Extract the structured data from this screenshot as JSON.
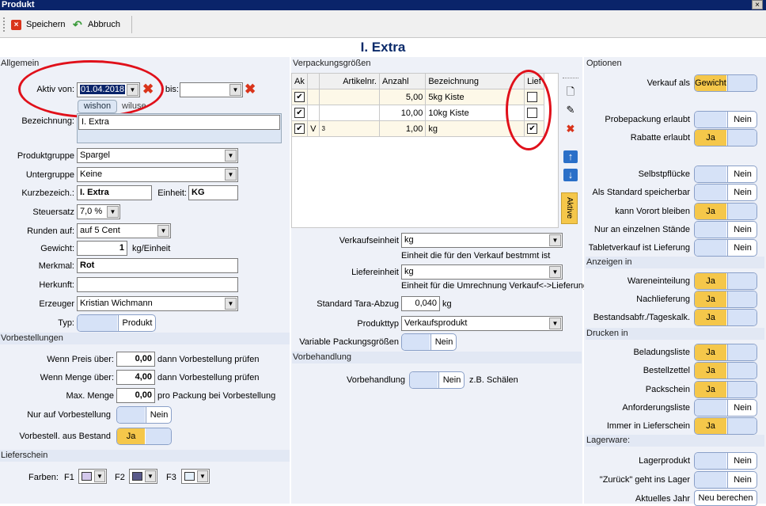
{
  "window": {
    "title": "Produkt",
    "close": "×"
  },
  "toolbar": {
    "save": "Speichern",
    "cancel": "Abbruch"
  },
  "page_title": "I. Extra",
  "allgemein": {
    "section": "Allgemein",
    "aktiv_von_label": "Aktiv von:",
    "aktiv_von": "01.04.2018",
    "bis_label": "bis:",
    "bis": "",
    "wishon": "wishon",
    "wiluse": "wiluse",
    "bezeichnung_label": "Bezeichnung:",
    "bezeichnung": "I. Extra",
    "produktgruppe_label": "Produktgruppe",
    "produktgruppe": "Spargel",
    "untergruppe_label": "Untergruppe",
    "untergruppe": "Keine",
    "kurzbez_label": "Kurzbezeich.:",
    "kurzbez": "I. Extra",
    "einheit_label": "Einheit:",
    "einheit": "KG",
    "steuersatz_label": "Steuersatz",
    "steuersatz": "7,0 %",
    "runden_label": "Runden auf:",
    "runden": "auf 5 Cent",
    "gewicht_label": "Gewicht:",
    "gewicht": "1",
    "gewicht_unit": "kg/Einheit",
    "merkmal_label": "Merkmal:",
    "merkmal": "Rot",
    "herkunft_label": "Herkunft:",
    "herkunft": "",
    "erzeuger_label": "Erzeuger",
    "erzeuger": "Kristian Wichmann",
    "typ_label": "Typ:",
    "typ": "Produkt"
  },
  "vorbestellungen": {
    "section": "Vorbestellungen",
    "preis_label": "Wenn Preis über:",
    "preis": "0,00",
    "preis_suffix": "dann Vorbestellung prüfen",
    "menge_label": "Wenn Menge über:",
    "menge": "4,00",
    "menge_suffix": "dann Vorbestellung prüfen",
    "max_label": "Max. Menge",
    "max": "0,00",
    "max_suffix": "pro Packung bei Vorbestellung",
    "nur_label": "Nur auf Vorbestellung",
    "nur": "Nein",
    "bestand_label": "Vorbestell. aus Bestand",
    "bestand": "Ja"
  },
  "lieferschein": {
    "section": "Lieferschein",
    "farben_label": "Farben:",
    "f1": "F1",
    "f2": "F2",
    "f3": "F3",
    "f1_color": "#d4c8ec",
    "f2_color": "#5a5a8a",
    "f3_color": "#e4f0fa"
  },
  "verpackung": {
    "section": "Verpackungsgrößen",
    "headers": [
      "Ak",
      "",
      "Artikelnr.",
      "Anzahl",
      "Bezeichnung",
      "Lief"
    ],
    "rows": [
      {
        "ak": "✔",
        "v": "",
        "art": "",
        "anzahl": "5,00",
        "bez": "5kg Kiste",
        "lief": ""
      },
      {
        "ak": "✔",
        "v": "",
        "art": "",
        "anzahl": "10,00",
        "bez": "10kg Kiste",
        "lief": ""
      },
      {
        "ak": "✔",
        "v": "V",
        "art": "3",
        "anzahl": "1,00",
        "bez": "kg",
        "lief": "✔"
      }
    ],
    "aktive_tab": "Aktive"
  },
  "mitte": {
    "verkaufseinheit_label": "Verkaufseinheit",
    "verkaufseinheit": "kg",
    "verkaufseinheit_hint": "Einheit die für den Verkauf bestmmt ist",
    "liefereinheit_label": "Liefereinheit",
    "liefereinheit": "kg",
    "liefereinheit_hint": "Einheit für die Umrechnung Verkauf<->Lieferung",
    "tara_label": "Standard Tara-Abzug",
    "tara": "0,040",
    "tara_unit": "kg",
    "produkttyp_label": "Produkttyp",
    "produkttyp": "Verkaufsprodukt",
    "variable_label": "Variable Packungsgrößen",
    "variable": "Nein",
    "vorbehandlung_section": "Vorbehandlung",
    "vorbehandlung_label": "Vorbehandlung",
    "vorbehandlung": "Nein",
    "vorbehandlung_hint": "z.B. Schälen"
  },
  "optionen": {
    "section": "Optionen",
    "verkauf_label": "Verkauf als",
    "verkauf": "Gewicht",
    "probe_label": "Probepackung erlaubt",
    "probe": "Nein",
    "rabatte_label": "Rabatte erlaubt",
    "rabatte": "Ja",
    "selbst_label": "Selbstpflücke",
    "selbst": "Nein",
    "standard_label": "Als Standard speicherbar",
    "standard": "Nein",
    "vorort_label": "kann Vorort bleiben",
    "vorort": "Ja",
    "staende_label": "Nur an einzelnen Stände",
    "staende": "Nein",
    "tablet_label": "Tabletverkauf ist Lieferung",
    "tablet": "Nein",
    "anzeigen_section": "Anzeigen in",
    "waren_label": "Wareneinteilung",
    "waren": "Ja",
    "nach_label": "Nachlieferung",
    "nach": "Ja",
    "bestand_label": "Bestandsabfr./Tageskalk.",
    "bestand": "Ja",
    "drucken_section": "Drucken in",
    "belad_label": "Beladungsliste",
    "belad": "Ja",
    "bestell_label": "Bestellzettel",
    "bestell": "Ja",
    "pack_label": "Packschein",
    "pack": "Ja",
    "anford_label": "Anforderungsliste",
    "anford": "Nein",
    "immer_label": "Immer in Lieferschein",
    "immer": "Ja",
    "lager_section": "Lagerware:",
    "lagerprodukt_label": "Lagerprodukt",
    "lagerprodukt": "Nein",
    "zurueck_label": "\"Zurück\" geht ins Lager",
    "zurueck": "Nein",
    "jahr_label": "Aktuelles Jahr",
    "jahr_btn": "Neu berechen"
  }
}
